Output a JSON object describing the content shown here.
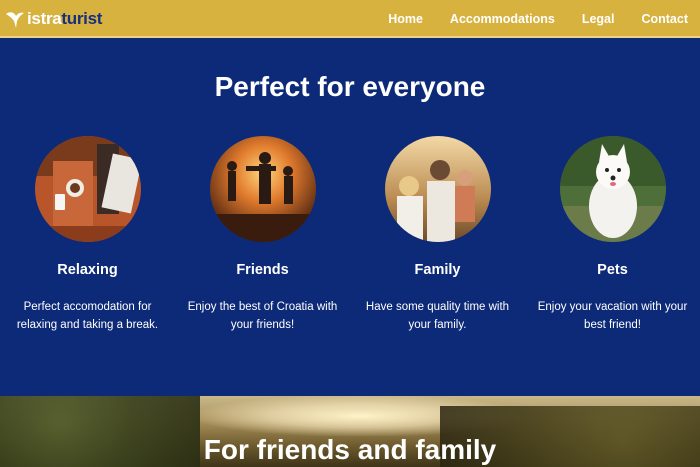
{
  "brand": {
    "part1": "istra",
    "part2": "turist",
    "colors": {
      "nav": "#d8b23f",
      "navy": "#0d2a78",
      "white": "#ffffff"
    }
  },
  "nav": {
    "items": [
      {
        "label": "Home"
      },
      {
        "label": "Accommodations"
      },
      {
        "label": "Legal"
      },
      {
        "label": "Contact"
      }
    ]
  },
  "features": {
    "title": "Perfect for everyone",
    "cards": [
      {
        "title": "Relaxing",
        "text": "Perfect accomodation for relaxing and taking a break.",
        "image": "relaxing-photo"
      },
      {
        "title": "Friends",
        "text": "Enjoy the best of Croatia with your friends!",
        "image": "friends-photo"
      },
      {
        "title": "Family",
        "text": "Have some quality time with your family.",
        "image": "family-photo"
      },
      {
        "title": "Pets",
        "text": "Enjoy your vacation with your best friend!",
        "image": "pets-photo"
      }
    ]
  },
  "hero": {
    "title": "For friends and family"
  }
}
